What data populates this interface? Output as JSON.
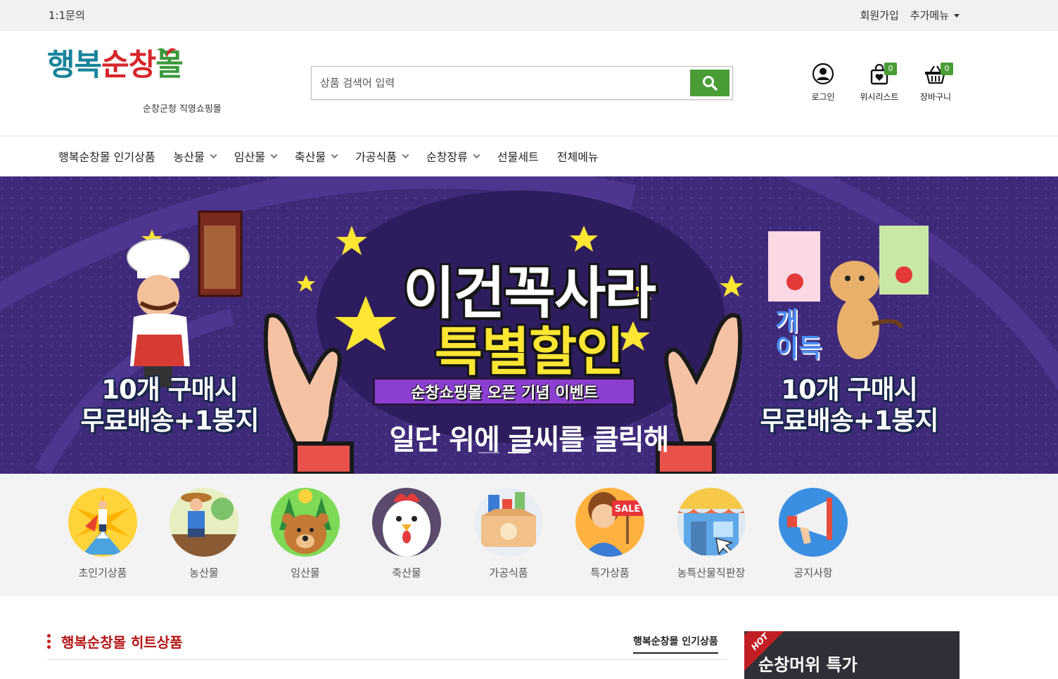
{
  "topbar": {
    "inquiry": "1:1문의",
    "signup": "회원가입",
    "more_menu": "추가메뉴"
  },
  "logo": {
    "part1": "행복",
    "part2": "순창",
    "part3": "몰",
    "subtitle": "순창군청 직영쇼핑몰"
  },
  "search": {
    "placeholder": "상품 검색어 입력",
    "icon": "search-icon"
  },
  "header_icons": [
    {
      "label": "로그인",
      "icon": "user-icon"
    },
    {
      "label": "위시리스트",
      "icon": "wishlist-bag-icon",
      "badge": "0"
    },
    {
      "label": "장바구니",
      "icon": "basket-icon",
      "badge": "0"
    }
  ],
  "nav": [
    {
      "label": "행복순창몰 인기상품",
      "dropdown": false
    },
    {
      "label": "농산물",
      "dropdown": true
    },
    {
      "label": "임산물",
      "dropdown": true
    },
    {
      "label": "축산물",
      "dropdown": true
    },
    {
      "label": "가공식품",
      "dropdown": true
    },
    {
      "label": "순창장류",
      "dropdown": true
    },
    {
      "label": "선물세트",
      "dropdown": false
    },
    {
      "label": "전체메뉴",
      "dropdown": false
    }
  ],
  "banner": {
    "title1": "이건꼭사라",
    "title2": "특별할인",
    "ribbon": "순창쇼핑몰 오픈 기념 이벤트",
    "click": "일단 위에 글씨를 클릭해",
    "left_line1": "10개 구매시",
    "left_line2": "무료배송+1봉지",
    "right_line1": "10개 구매시",
    "right_line2": "무료배송+1봉지",
    "dog_text1": "개",
    "dog_text2": "이득",
    "slides": 2,
    "active_slide": 2,
    "colors": {
      "bg": "#3f2a7a",
      "yellow": "#ffe633",
      "ribbon": "#8a3fd0"
    }
  },
  "categories": [
    {
      "label": "초인기상품",
      "icon": "superhero-icon"
    },
    {
      "label": "농산물",
      "icon": "farmer-icon"
    },
    {
      "label": "임산물",
      "icon": "bear-forest-icon"
    },
    {
      "label": "축산물",
      "icon": "rooster-icon"
    },
    {
      "label": "가공식품",
      "icon": "food-box-icon"
    },
    {
      "label": "특가상품",
      "icon": "sale-sign-icon"
    },
    {
      "label": "농특산물직판장",
      "icon": "storefront-icon"
    },
    {
      "label": "공지사항",
      "icon": "megaphone-icon"
    }
  ],
  "section": {
    "title": "행복순창몰 히트상품",
    "tab": "행복순창몰 인기상품",
    "hot_badge": "HOT",
    "hot_title": "순창머위 특가"
  },
  "colors": {
    "brand_green": "#4a9c35",
    "brand_teal": "#17849b",
    "brand_red": "#d7262b",
    "section_red": "#b51515"
  }
}
